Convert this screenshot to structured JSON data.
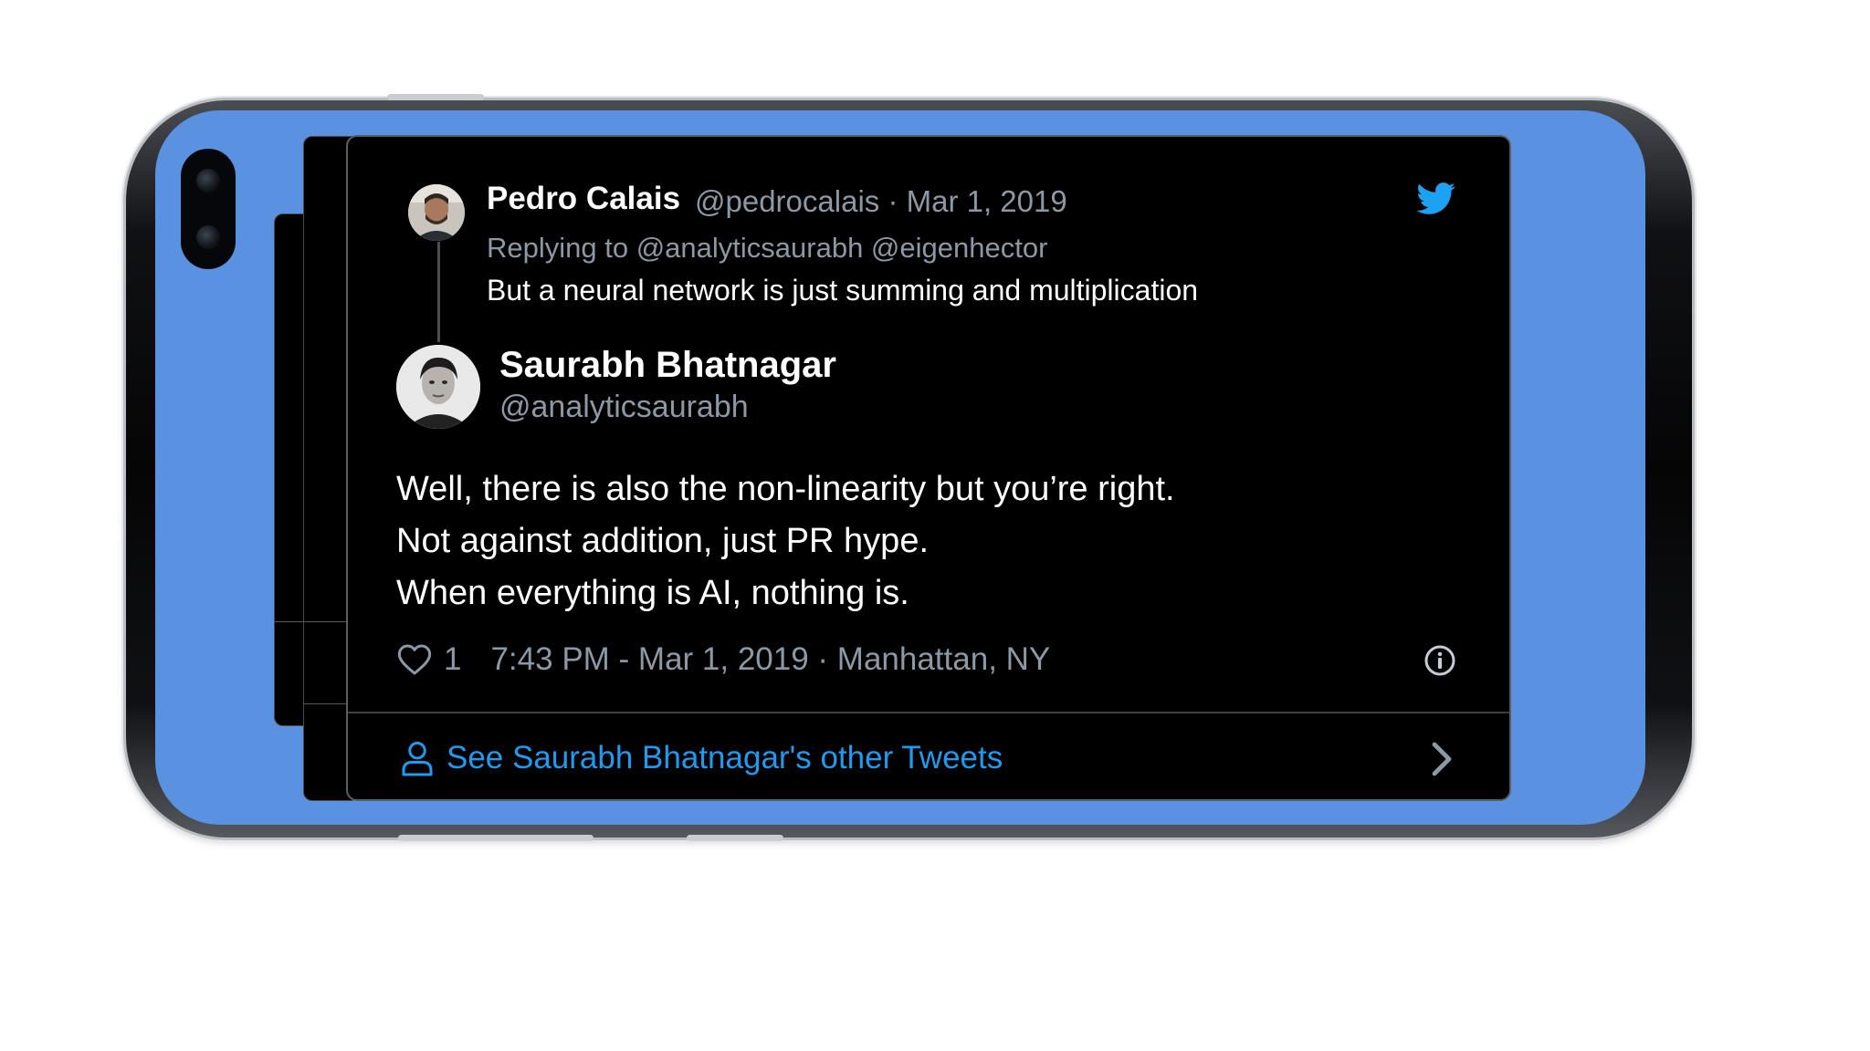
{
  "parent_tweet": {
    "name": "Pedro Calais",
    "handle_date": "@pedrocalais · Mar 1, 2019",
    "replying_to": "Replying to @analyticsaurabh @eigenhector",
    "text": "But a neural network is just summing and multiplication"
  },
  "main_tweet": {
    "name": "Saurabh Bhatnagar",
    "handle": "@analyticsaurabh",
    "body_lines": [
      "Well, there is also the non-linearity but you’re right.",
      "Not against addition, just PR hype.",
      "When everything is AI, nothing is."
    ],
    "like_count": "1",
    "timestamp_location": "7:43 PM - Mar 1, 2019 · Manhattan, NY"
  },
  "footer": {
    "link_text": "See Saurabh Bhatnagar's other Tweets"
  },
  "icons": [
    "twitter-bird-icon",
    "heart-icon",
    "info-icon",
    "user-icon",
    "chevron-right-icon"
  ],
  "colors": {
    "screen_background": "#5a91e0",
    "card_background": "#000000",
    "link_blue": "#1d9bf0",
    "twitter_blue": "#1da1f2",
    "secondary_text": "#8b98a5"
  }
}
